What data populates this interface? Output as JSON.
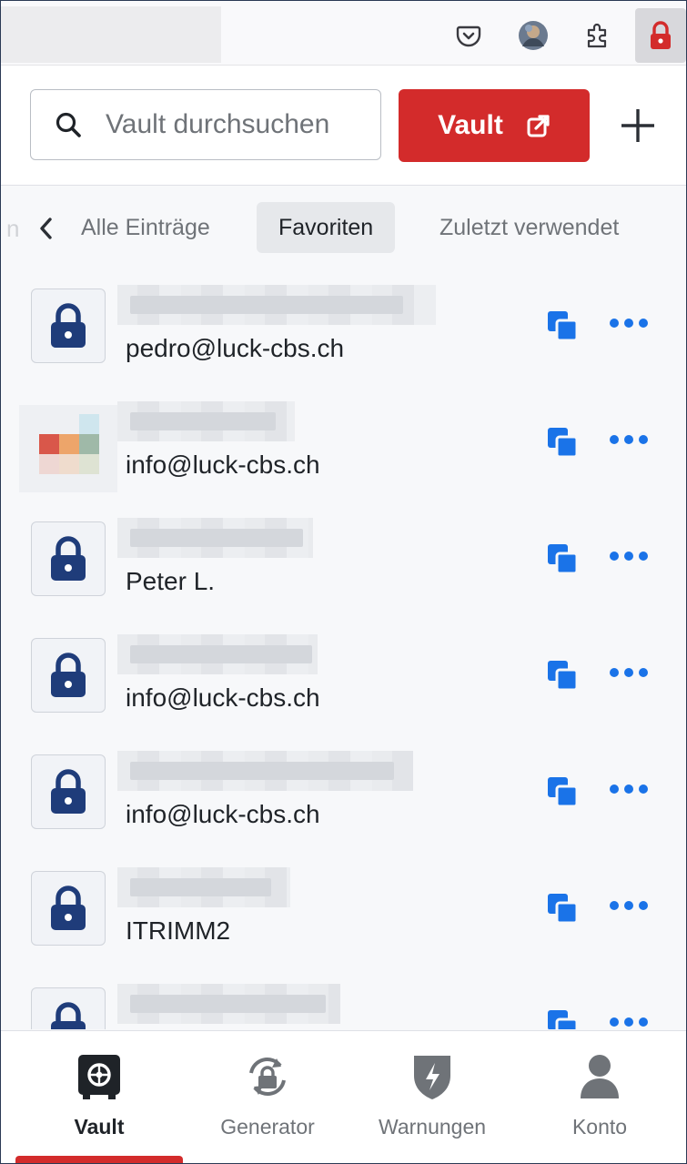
{
  "browser": {
    "toolbar_icons": [
      "pocket-icon",
      "avatar",
      "extensions-icon",
      "bitwarden-lock-icon"
    ]
  },
  "header": {
    "search_placeholder": "Vault durchsuchen",
    "vault_button_label": "Vault",
    "add_icon": "plus-icon"
  },
  "tabs": {
    "items": [
      {
        "label": "Alle Einträge"
      },
      {
        "label": "Favoriten"
      },
      {
        "label": "Zuletzt verwendet"
      }
    ],
    "selected": "Favoriten"
  },
  "items": [
    {
      "subtitle": "pedro@luck-cbs.ch",
      "icon": "lock-icon"
    },
    {
      "subtitle": "info@luck-cbs.ch",
      "icon": "site-favicon"
    },
    {
      "subtitle": "Peter L.",
      "icon": "lock-icon"
    },
    {
      "subtitle": "info@luck-cbs.ch",
      "icon": "lock-icon"
    },
    {
      "subtitle": "info@luck-cbs.ch",
      "icon": "lock-icon"
    },
    {
      "subtitle": "ITRIMM2",
      "icon": "lock-icon"
    },
    {
      "subtitle": "",
      "icon": "lock-icon"
    }
  ],
  "nav": {
    "items": [
      {
        "label": "Vault",
        "icon": "vault-icon"
      },
      {
        "label": "Generator",
        "icon": "generator-icon"
      },
      {
        "label": "Warnungen",
        "icon": "warning-shield-icon"
      },
      {
        "label": "Konto",
        "icon": "account-icon"
      }
    ],
    "active": "Vault"
  },
  "colors": {
    "accent_red": "#d32b2b",
    "action_blue": "#1a73e8",
    "lock_navy": "#1f3c7a"
  }
}
